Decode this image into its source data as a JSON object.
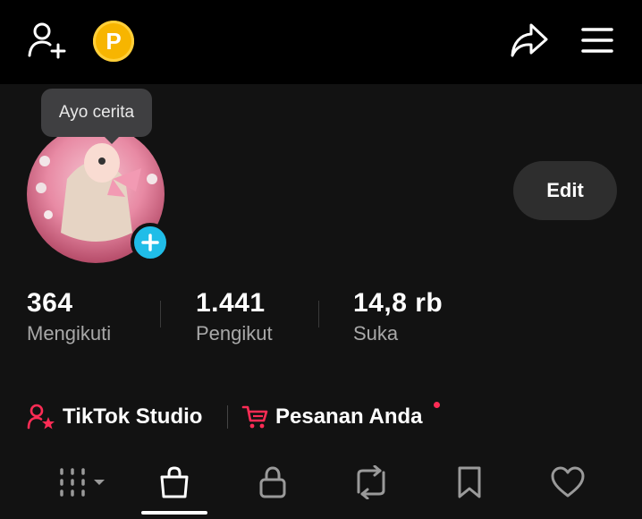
{
  "topbar": {
    "add_friend_icon": "person-add-icon",
    "coin_label": "P",
    "share_icon": "share-icon",
    "menu_icon": "menu-icon"
  },
  "profile": {
    "tooltip": "Ayo cerita",
    "edit_label": "Edit"
  },
  "stats": [
    {
      "value": "364",
      "label": "Mengikuti"
    },
    {
      "value": "1.441",
      "label": "Pengikut"
    },
    {
      "value": "14,8 rb",
      "label": "Suka"
    }
  ],
  "links": {
    "studio": "TikTok Studio",
    "orders": "Pesanan Anda"
  },
  "tabs": [
    "grid-icon",
    "shopping-bag-icon",
    "lock-icon",
    "repost-icon",
    "bookmark-icon",
    "heart-icon"
  ],
  "colors": {
    "accent_red": "#fe2c55",
    "accent_blue": "#20bde8",
    "coin": "#f7b500"
  }
}
